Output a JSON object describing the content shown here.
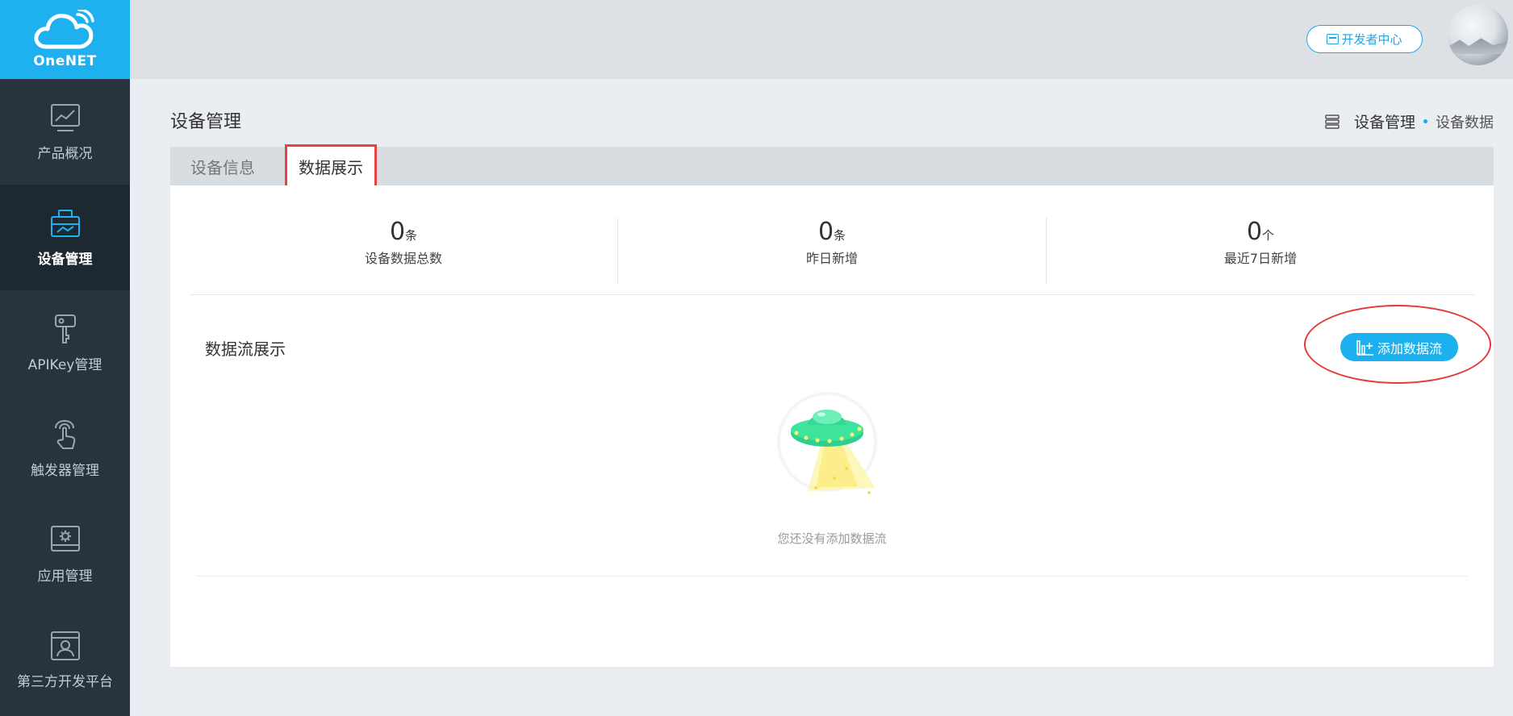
{
  "brand": {
    "name": "OneNET"
  },
  "sidebar": {
    "items": [
      {
        "label": "产品概况",
        "icon": "chart-monitor-icon",
        "active": false
      },
      {
        "label": "设备管理",
        "icon": "device-box-icon",
        "active": true
      },
      {
        "label": "APIKey管理",
        "icon": "key-icon",
        "active": false
      },
      {
        "label": "触发器管理",
        "icon": "touch-hand-icon",
        "active": false
      },
      {
        "label": "应用管理",
        "icon": "app-gear-icon",
        "active": false
      },
      {
        "label": "第三方开发平台",
        "icon": "user-window-icon",
        "active": false
      }
    ]
  },
  "header": {
    "dev_center_label": "开发者中心"
  },
  "page": {
    "title": "设备管理",
    "breadcrumb": {
      "parent": "设备管理",
      "current": "设备数据"
    }
  },
  "tabs": [
    {
      "label": "设备信息",
      "active": false
    },
    {
      "label": "数据展示",
      "active": true
    }
  ],
  "stats": [
    {
      "value": "0",
      "unit": "条",
      "label": "设备数据总数"
    },
    {
      "value": "0",
      "unit": "条",
      "label": "昨日新增"
    },
    {
      "value": "0",
      "unit": "个",
      "label": "最近7日新增"
    }
  ],
  "datastream": {
    "title": "数据流展示",
    "add_button": "添加数据流",
    "empty_text": "您还没有添加数据流"
  },
  "colors": {
    "accent": "#1cb1ee",
    "sidebar": "#27333d",
    "highlight": "#e23a3a"
  }
}
